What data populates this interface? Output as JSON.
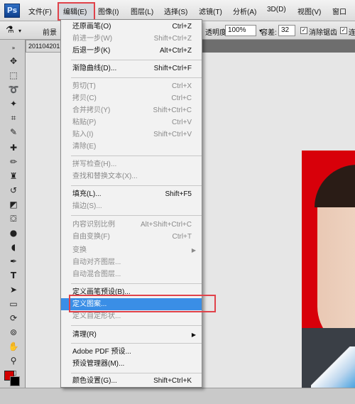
{
  "app": {
    "logo": "Ps"
  },
  "menubar": {
    "items": [
      {
        "label": "文件(F)"
      },
      {
        "label": "编辑(E)"
      },
      {
        "label": "图像(I)"
      },
      {
        "label": "图层(L)"
      },
      {
        "label": "选择(S)"
      },
      {
        "label": "滤镜(T)"
      },
      {
        "label": "分析(A)"
      },
      {
        "label": "3D(D)"
      },
      {
        "label": "视图(V)"
      },
      {
        "label": "窗口"
      }
    ]
  },
  "options": {
    "fg_label": "前景",
    "opacity_label": "透明度:",
    "opacity_value": "100%",
    "tolerance_label": "容差:",
    "tolerance_value": "32",
    "antialias_label": "消除锯齿",
    "contiguous_label": "连"
  },
  "document": {
    "tab_title": "201104201"
  },
  "edit_menu": {
    "items": [
      {
        "label": "还原画笔(O)",
        "shortcut": "Ctrl+Z",
        "enabled": true
      },
      {
        "label": "前进一步(W)",
        "shortcut": "Shift+Ctrl+Z",
        "enabled": false
      },
      {
        "label": "后退一步(K)",
        "shortcut": "Alt+Ctrl+Z",
        "enabled": true
      },
      {
        "label": "渐隐曲线(D)...",
        "shortcut": "Shift+Ctrl+F",
        "enabled": true
      },
      {
        "label": "剪切(T)",
        "shortcut": "Ctrl+X",
        "enabled": false
      },
      {
        "label": "拷贝(C)",
        "shortcut": "Ctrl+C",
        "enabled": false
      },
      {
        "label": "合并拷贝(Y)",
        "shortcut": "Shift+Ctrl+C",
        "enabled": false
      },
      {
        "label": "粘贴(P)",
        "shortcut": "Ctrl+V",
        "enabled": false
      },
      {
        "label": "贴入(I)",
        "shortcut": "Shift+Ctrl+V",
        "enabled": false
      },
      {
        "label": "清除(E)",
        "shortcut": "",
        "enabled": false
      },
      {
        "label": "拼写检查(H)...",
        "shortcut": "",
        "enabled": false
      },
      {
        "label": "查找和替换文本(X)...",
        "shortcut": "",
        "enabled": false
      },
      {
        "label": "填充(L)...",
        "shortcut": "Shift+F5",
        "enabled": true
      },
      {
        "label": "描边(S)...",
        "shortcut": "",
        "enabled": false
      },
      {
        "label": "内容识别比例",
        "shortcut": "Alt+Shift+Ctrl+C",
        "enabled": false
      },
      {
        "label": "自由变换(F)",
        "shortcut": "Ctrl+T",
        "enabled": false
      },
      {
        "label": "变换",
        "shortcut": "",
        "enabled": false
      },
      {
        "label": "自动对齐图层...",
        "shortcut": "",
        "enabled": false
      },
      {
        "label": "自动混合图层...",
        "shortcut": "",
        "enabled": false
      },
      {
        "label": "定义画笔预设(B)...",
        "shortcut": "",
        "enabled": true
      },
      {
        "label": "定义图案...",
        "shortcut": "",
        "enabled": true
      },
      {
        "label": "定义自定形状...",
        "shortcut": "",
        "enabled": false
      },
      {
        "label": "清理(R)",
        "shortcut": "",
        "enabled": true
      },
      {
        "label": "Adobe PDF 预设...",
        "shortcut": "",
        "enabled": true
      },
      {
        "label": "预设管理器(M)...",
        "shortcut": "",
        "enabled": true
      },
      {
        "label": "颜色设置(G)...",
        "shortcut": "Shift+Ctrl+K",
        "enabled": true
      }
    ]
  },
  "colors": {
    "accent_highlight": "#3a8ee6",
    "annotation_red": "#e0424a",
    "foreground_swatch": "#d40000",
    "background_swatch": "#000000",
    "photo_background": "#d8000a"
  }
}
